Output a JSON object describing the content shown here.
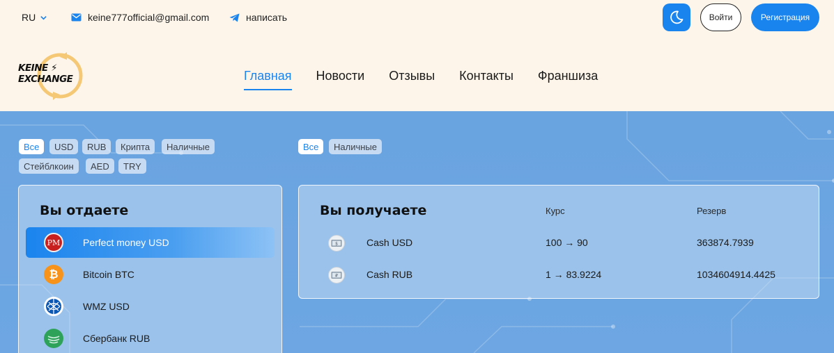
{
  "header": {
    "language": "RU",
    "email": "keine777official@gmail.com",
    "write_label": "написать",
    "login_label": "Войти",
    "register_label": "Регистрация"
  },
  "logo": {
    "line1": "KEINE",
    "line2": "EXCHANGE"
  },
  "nav": {
    "home": "Главная",
    "news": "Новости",
    "reviews": "Отзывы",
    "contacts": "Контакты",
    "franchise": "Франшиза"
  },
  "filters_give": [
    "Все",
    "USD",
    "RUB",
    "Крипта",
    "Наличные",
    "Стейблкоин",
    "AED",
    "TRY"
  ],
  "filters_get": [
    "Все",
    "Наличные"
  ],
  "give_panel": {
    "title": "Вы отдаете",
    "items": [
      {
        "label": "Perfect money USD",
        "icon": "perfect-money-icon",
        "icon_text": "PM"
      },
      {
        "label": "Bitcoin BTC",
        "icon": "bitcoin-icon"
      },
      {
        "label": "WMZ USD",
        "icon": "webmoney-icon"
      },
      {
        "label": "Сбербанк RUB",
        "icon": "sberbank-icon"
      }
    ]
  },
  "get_panel": {
    "title": "Вы получаете",
    "rate_header": "Курс",
    "reserve_header": "Резерв",
    "rows": [
      {
        "name": "Cash USD",
        "rate": "100 → 90",
        "reserve": "363874.7939",
        "icon": "cash-usd-icon"
      },
      {
        "name": "Cash RUB",
        "rate": "1 → 83.9224",
        "reserve": "1034604914.4425",
        "icon": "cash-rub-icon"
      }
    ]
  },
  "colors": {
    "accent": "#1a84ee",
    "header_bg": "#fdf5ea",
    "section_bg": "#6aa4e0"
  }
}
